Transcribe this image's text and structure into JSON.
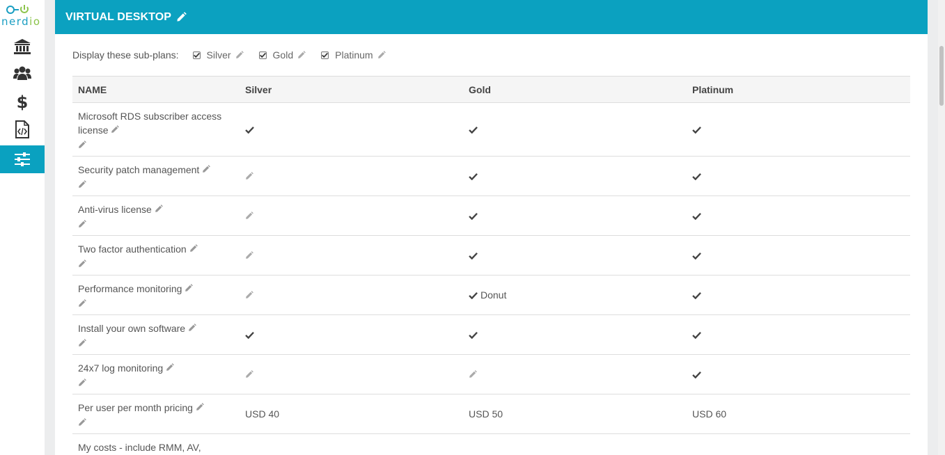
{
  "brand": {
    "name": "nerd",
    "name_suffix": "io",
    "primary_color": "#0ba1c0",
    "accent_color": "#8bc34a"
  },
  "sidebar": {
    "items": [
      {
        "icon": "bank-icon",
        "active": false
      },
      {
        "icon": "users-icon",
        "active": false
      },
      {
        "icon": "dollar-icon",
        "active": false
      },
      {
        "icon": "code-file-icon",
        "active": false
      },
      {
        "icon": "sliders-icon",
        "active": true
      }
    ]
  },
  "header": {
    "title": "VIRTUAL DESKTOP"
  },
  "subplans": {
    "label": "Display these sub-plans:",
    "items": [
      {
        "name": "Silver",
        "checked": true
      },
      {
        "name": "Gold",
        "checked": true
      },
      {
        "name": "Platinum",
        "checked": true
      }
    ]
  },
  "table": {
    "headers": [
      "NAME",
      "Silver",
      "Gold",
      "Platinum"
    ],
    "rows": [
      {
        "name": "Microsoft RDS subscriber access license",
        "silver": {
          "type": "check",
          "text": ""
        },
        "gold": {
          "type": "check",
          "text": ""
        },
        "platinum": {
          "type": "check",
          "text": ""
        }
      },
      {
        "name": "Security patch management",
        "silver": {
          "type": "edit",
          "text": ""
        },
        "gold": {
          "type": "check",
          "text": ""
        },
        "platinum": {
          "type": "check",
          "text": ""
        }
      },
      {
        "name": "Anti-virus license",
        "silver": {
          "type": "edit",
          "text": ""
        },
        "gold": {
          "type": "check",
          "text": ""
        },
        "platinum": {
          "type": "check",
          "text": ""
        }
      },
      {
        "name": "Two factor authentication",
        "silver": {
          "type": "edit",
          "text": ""
        },
        "gold": {
          "type": "check",
          "text": ""
        },
        "platinum": {
          "type": "check",
          "text": ""
        }
      },
      {
        "name": "Performance monitoring",
        "silver": {
          "type": "edit",
          "text": ""
        },
        "gold": {
          "type": "check",
          "text": "Donut"
        },
        "platinum": {
          "type": "check",
          "text": ""
        }
      },
      {
        "name": "Install your own software",
        "silver": {
          "type": "check",
          "text": ""
        },
        "gold": {
          "type": "check",
          "text": ""
        },
        "platinum": {
          "type": "check",
          "text": ""
        }
      },
      {
        "name": "24x7 log monitoring",
        "silver": {
          "type": "edit",
          "text": ""
        },
        "gold": {
          "type": "edit",
          "text": ""
        },
        "platinum": {
          "type": "check",
          "text": ""
        }
      },
      {
        "name": "Per user per month pricing",
        "silver": {
          "type": "text",
          "text": "USD 40"
        },
        "gold": {
          "type": "text",
          "text": "USD 50"
        },
        "platinum": {
          "type": "text",
          "text": "USD 60"
        }
      },
      {
        "name": "My costs - include RMM, AV,",
        "silver": {
          "type": "none",
          "text": ""
        },
        "gold": {
          "type": "none",
          "text": ""
        },
        "platinum": {
          "type": "none",
          "text": ""
        }
      }
    ]
  }
}
